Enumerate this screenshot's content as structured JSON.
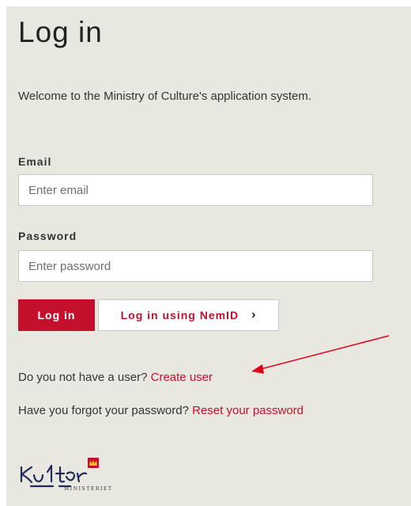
{
  "page": {
    "title": "Log in",
    "welcome": "Welcome to the Ministry of Culture's application system."
  },
  "form": {
    "email_label": "Email",
    "email_placeholder": "Enter email",
    "password_label": "Password",
    "password_placeholder": "Enter password"
  },
  "buttons": {
    "login": "Log in",
    "nemid": "Log in using NemID"
  },
  "links": {
    "no_user_text": "Do you not have a user?",
    "create_user": "Create user",
    "forgot_text": "Have you forgot your password?",
    "reset_password": "Reset your password"
  },
  "logo": {
    "wordmark": "Kultur",
    "subtitle": "MINISTERIET"
  },
  "colors": {
    "accent": "#c5102d",
    "panel_bg": "#e9e8e0",
    "annotation_arrow": "#e0001a"
  }
}
